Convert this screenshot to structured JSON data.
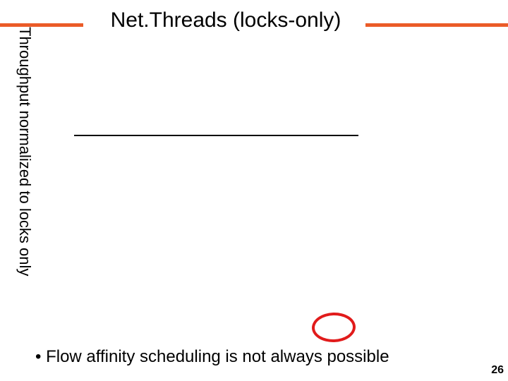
{
  "header": {
    "title": "Net.Threads (locks-only)"
  },
  "chart_data": {
    "type": "bar",
    "title": "Net.Threads (locks-only)",
    "ylabel": "Throughput normalized to locks only",
    "xlabel": "",
    "categories": [],
    "values": [],
    "ylim": [
      0,
      1
    ]
  },
  "bullet": {
    "text": "• Flow affinity scheduling is not always possible"
  },
  "footer": {
    "page_number": "26"
  }
}
